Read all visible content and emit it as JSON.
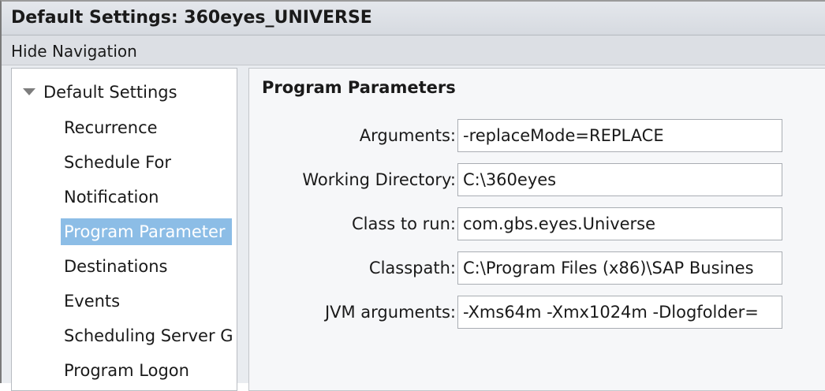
{
  "window": {
    "title": "Default Settings: 360eyes_UNIVERSE"
  },
  "navbar": {
    "hide_navigation": "Hide Navigation"
  },
  "sidebar": {
    "root": {
      "label": "Default Settings",
      "icon": "caret-down-icon",
      "expanded": true
    },
    "items": [
      {
        "label": "Recurrence",
        "selected": false
      },
      {
        "label": "Schedule For",
        "selected": false
      },
      {
        "label": "Notification",
        "selected": false
      },
      {
        "label": "Program Parameter",
        "selected": true
      },
      {
        "label": "Destinations",
        "selected": false
      },
      {
        "label": "Events",
        "selected": false
      },
      {
        "label": "Scheduling Server G",
        "selected": false
      },
      {
        "label": "Program Logon",
        "selected": false
      }
    ]
  },
  "main": {
    "section_title": "Program Parameters",
    "fields": {
      "arguments": {
        "label": "Arguments:",
        "value": "-replaceMode=REPLACE"
      },
      "working_directory": {
        "label": "Working Directory:",
        "value": "C:\\360eyes"
      },
      "class_to_run": {
        "label": "Class to run:",
        "value": "com.gbs.eyes.Universe"
      },
      "classpath": {
        "label": "Classpath:",
        "value": "C:\\Program Files (x86)\\SAP Busines"
      },
      "jvm_arguments": {
        "label": "JVM arguments:",
        "value": "-Xms64m -Xmx1024m -Dlogfolder="
      }
    }
  },
  "colors": {
    "selection": "#8cbde6",
    "titlebar": "#d6dae0",
    "panel_border": "#b8bcc2"
  }
}
